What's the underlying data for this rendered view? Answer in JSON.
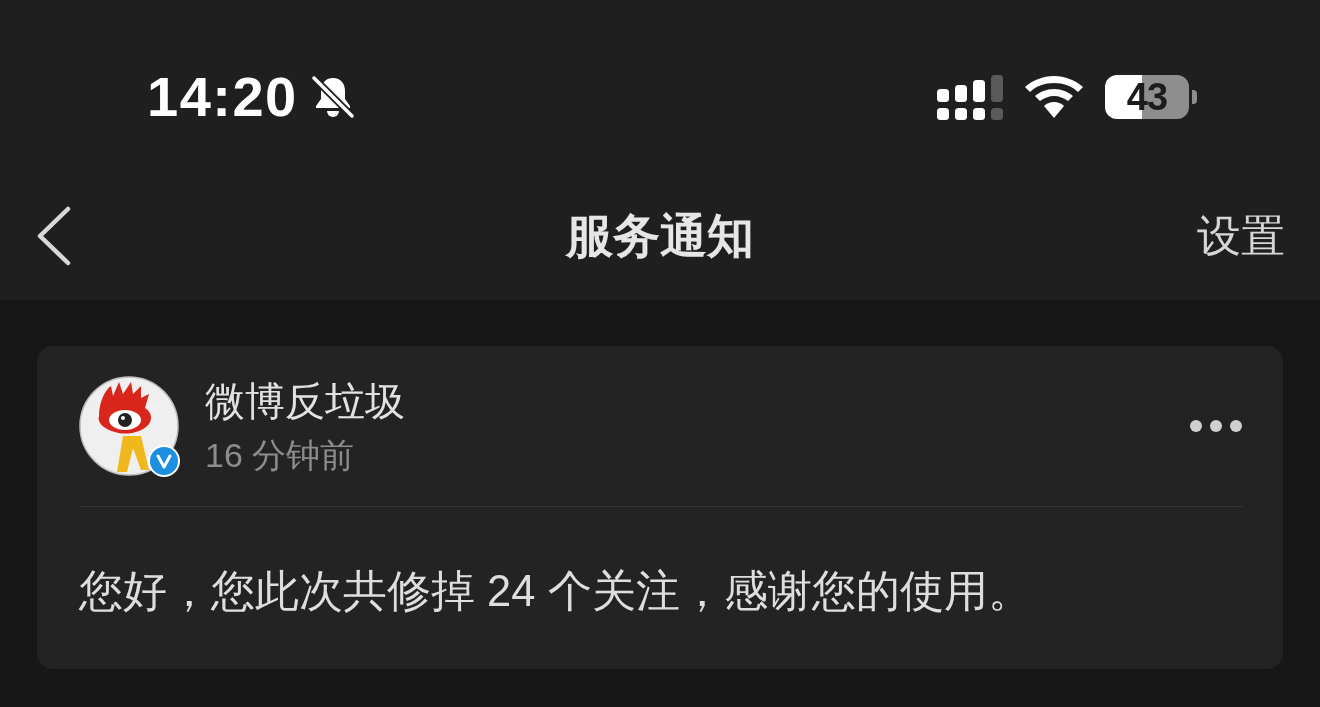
{
  "status_bar": {
    "time": "14:20",
    "silent": true,
    "battery": "43"
  },
  "nav_bar": {
    "title": "服务通知",
    "action": "设置"
  },
  "notifications": [
    {
      "sender": "微博反垃圾",
      "verified": true,
      "time": "16 分钟前",
      "message": "您好，您此次共修掉 24 个关注，感谢您的使用。"
    }
  ]
}
